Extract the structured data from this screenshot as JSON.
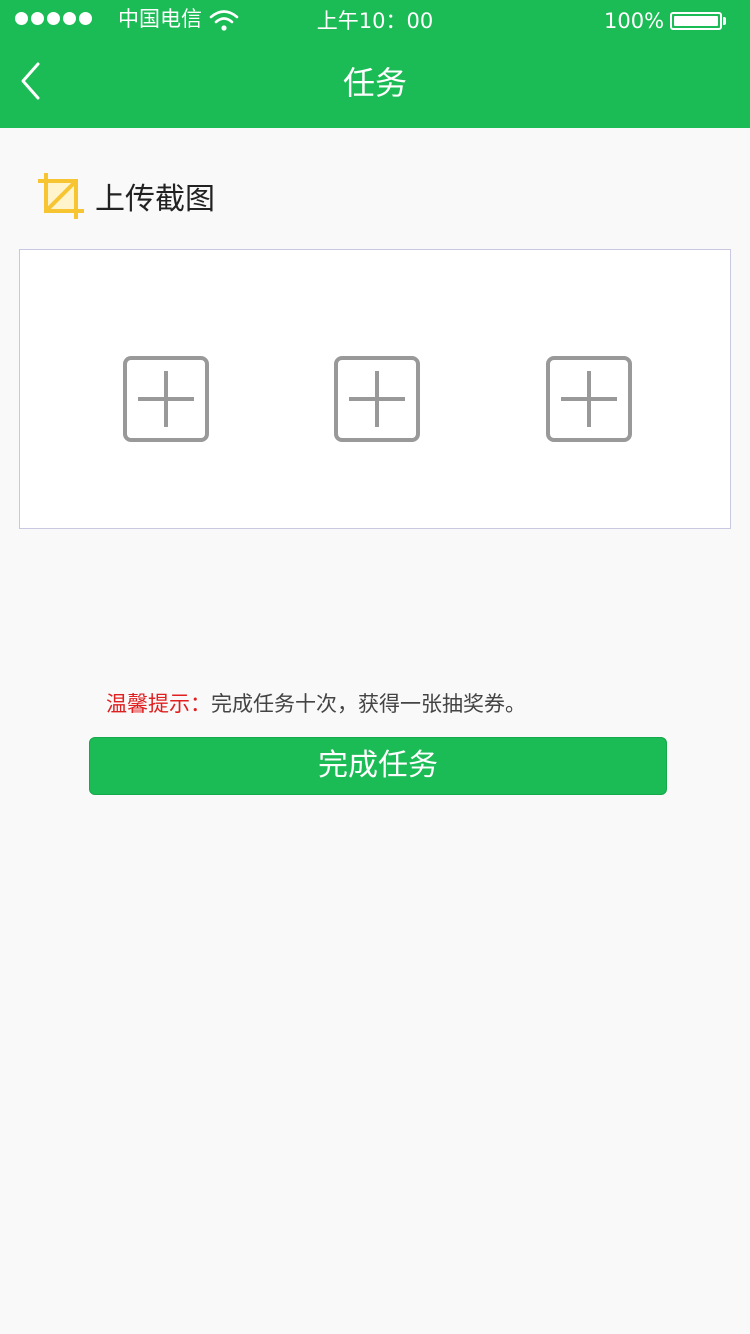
{
  "status_bar": {
    "carrier": "中国电信",
    "time": "上午10：00",
    "battery_percent": "100%",
    "battery_level": 1.0,
    "signal_bars": 5
  },
  "header": {
    "title": "任务",
    "back_icon": "chevron-left-icon",
    "background_color": "#1bbb55"
  },
  "upload": {
    "section_title": "上传截图",
    "section_icon": "crop-icon",
    "icon_color": "#f7c531",
    "slots": [
      {
        "icon": "plus-square-icon"
      },
      {
        "icon": "plus-square-icon"
      },
      {
        "icon": "plus-square-icon"
      }
    ]
  },
  "tip": {
    "label": "温馨提示：",
    "text": "完成任务十次，获得一张抽奖券。",
    "label_color": "#e02020"
  },
  "actions": {
    "complete_label": "完成任务",
    "button_color": "#1bbb55"
  }
}
